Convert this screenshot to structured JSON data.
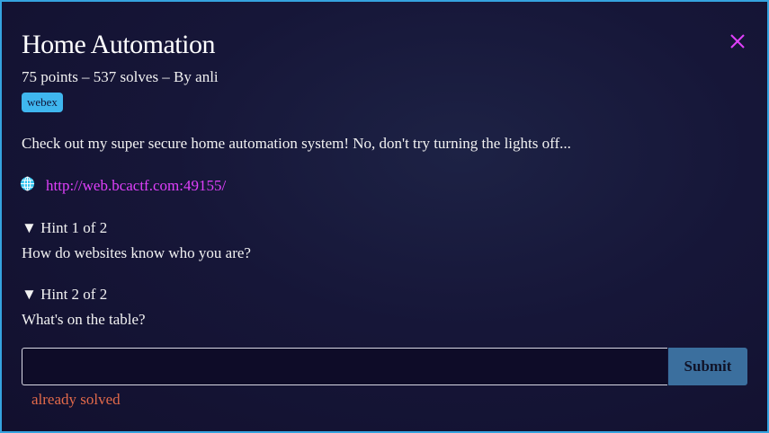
{
  "challenge": {
    "title": "Home Automation",
    "meta": "75 points – 537 solves – By anli",
    "tag": "webex",
    "description": "Check out my super secure home automation system! No, don't try turning the lights off...",
    "link": "http://web.bcactf.com:49155/"
  },
  "hints": [
    {
      "title": "▼ Hint 1 of 2",
      "body": "How do websites know who you are?"
    },
    {
      "title": "▼ Hint 2 of 2",
      "body": "What's on the table?"
    }
  ],
  "form": {
    "input_value": "",
    "submit_label": "Submit",
    "status": "already solved"
  },
  "icons": {
    "close": "close-icon",
    "link": "globe-icon"
  },
  "colors": {
    "border": "#35a3df",
    "tag_bg": "#3fb6ee",
    "link": "#e040fb",
    "close": "#e040fb",
    "submit_bg": "#3b6f9e",
    "status": "#e26a4a"
  }
}
